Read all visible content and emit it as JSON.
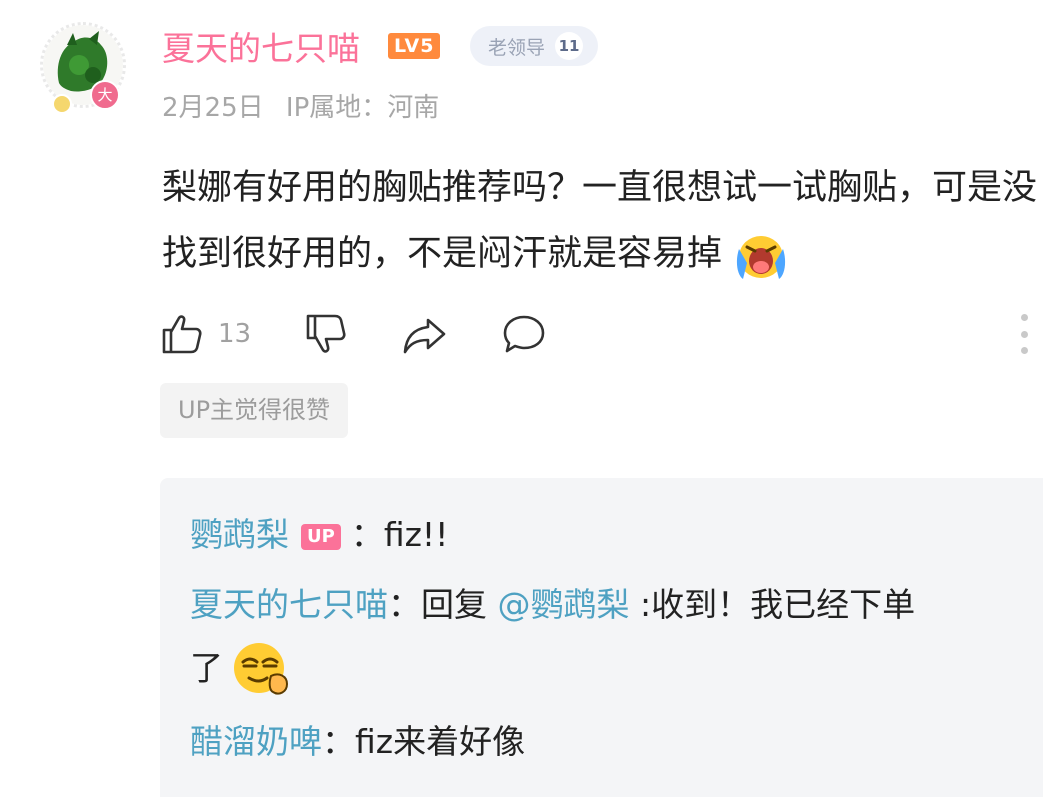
{
  "comment": {
    "username": "夏天的七只喵",
    "level": "LV5",
    "fan_badge": {
      "name": "老领导",
      "level": "11"
    },
    "avatar_badge": "大",
    "date": "2月25日",
    "ip_location": "IP属地：河南",
    "text": "梨娜有好用的胸贴推荐吗？一直很想试一试胸贴，可是没找到很好用的，不是闷汗就是容易掉",
    "emoji": "crying-face",
    "like_count": "13",
    "up_liked_label": "UP主觉得很赞"
  },
  "replies": [
    {
      "author": "鹦鹉梨",
      "tag": "UP",
      "separator": "：",
      "text": "fiz!!"
    },
    {
      "author": "夏天的七只喵",
      "separator": "：",
      "prefix": "回复 ",
      "mention": "@鹦鹉梨",
      "text": " :收到！我已经下单",
      "continuation": "了",
      "emoji": "smug-face"
    },
    {
      "author": "醋溜奶啤",
      "separator": "：",
      "text": "fiz来着好像"
    }
  ],
  "colors": {
    "username": "#fb7299",
    "reply_name": "#4ea1c2",
    "level_badge": "#ff8a3d",
    "up_tag": "#fb7299"
  },
  "icons": [
    "thumbs-up-icon",
    "thumbs-down-icon",
    "share-icon",
    "reply-icon",
    "more-icon"
  ]
}
